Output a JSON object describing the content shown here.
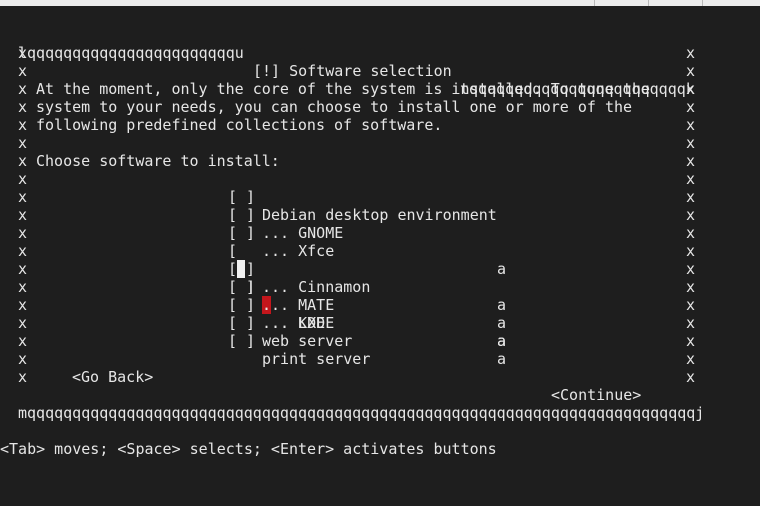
{
  "dialog": {
    "top_left": "lqqqqqqqqqqqqqqqqqqqqqqqu",
    "title": "[!] Software selection",
    "top_right": "tqqqqqqqqqqqqqqqqqqqqqqqqk",
    "side_char": "x",
    "bottom_border": "mqqqqqqqqqqqqqqqqqqqqqqqqqqqqqqqqqqqqqqqqqqqqqqqqqqqqqqqqqqqqqqqqqqqqqqqqqqj",
    "intro_lines": [
      "At the moment, only the core of the system is installed. To tune the",
      "system to your needs, you can choose to install one or more of the",
      "following predefined collections of software."
    ],
    "prompt": "Choose software to install:"
  },
  "software_list": [
    {
      "checkbox": "[ ]",
      "label": "Debian desktop environment",
      "marker": ""
    },
    {
      "checkbox": "[ ]",
      "label": "... GNOME",
      "marker": ""
    },
    {
      "checkbox": "[ ]",
      "label": "... Xfce",
      "marker": "a"
    },
    {
      "checkbox": "[ ]",
      "label": "... KDE",
      "marker": "a"
    },
    {
      "checkbox": "[ ]",
      "label": "... Cinnamon",
      "marker": "a"
    },
    {
      "checkbox": "[ ]",
      "label": "... MATE",
      "marker": "a"
    },
    {
      "checkbox": "[ ]",
      "label": "... LXDE",
      "marker": "a"
    },
    {
      "checkbox": "[ ]",
      "label": "web server",
      "marker": "a"
    },
    {
      "checkbox": "[ ]",
      "label": "print server",
      "marker": ""
    }
  ],
  "kde_row": {
    "open_bracket": "[",
    "close_bracket": "]",
    "dot": ".",
    "rest": ".. KDE"
  },
  "buttons": {
    "back": "<Go Back>",
    "continue": "<Continue>"
  },
  "help_text": "<Tab> moves; <Space> selects; <Enter> activates buttons",
  "colors": {
    "background": "#1e1e1e",
    "text": "#e6e6e6",
    "cursor": "#f0f0f0",
    "highlight": "#c4161c"
  }
}
